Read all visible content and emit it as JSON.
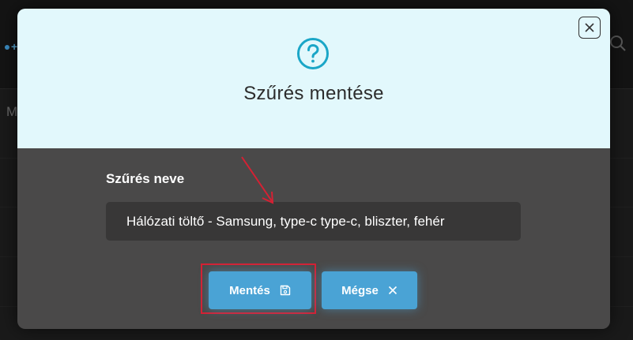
{
  "background": {
    "partial_letter": "M"
  },
  "modal": {
    "title": "Szűrés mentése",
    "field_label": "Szűrés neve",
    "field_value": "Hálózati töltő - Samsung, type-c type-c, bliszter, fehér",
    "save_button_label": "Mentés",
    "cancel_button_label": "Mégse",
    "header_icon": "question-circle-icon",
    "close_icon": "close-icon",
    "save_icon": "floppy-disk-icon",
    "cancel_icon": "x-icon"
  },
  "colors": {
    "header_background": "#e2f8fc",
    "body_background": "#4a4949",
    "accent": "#4aa3d5",
    "icon_teal": "#1aa6c7",
    "annotation_red": "#d62033"
  }
}
